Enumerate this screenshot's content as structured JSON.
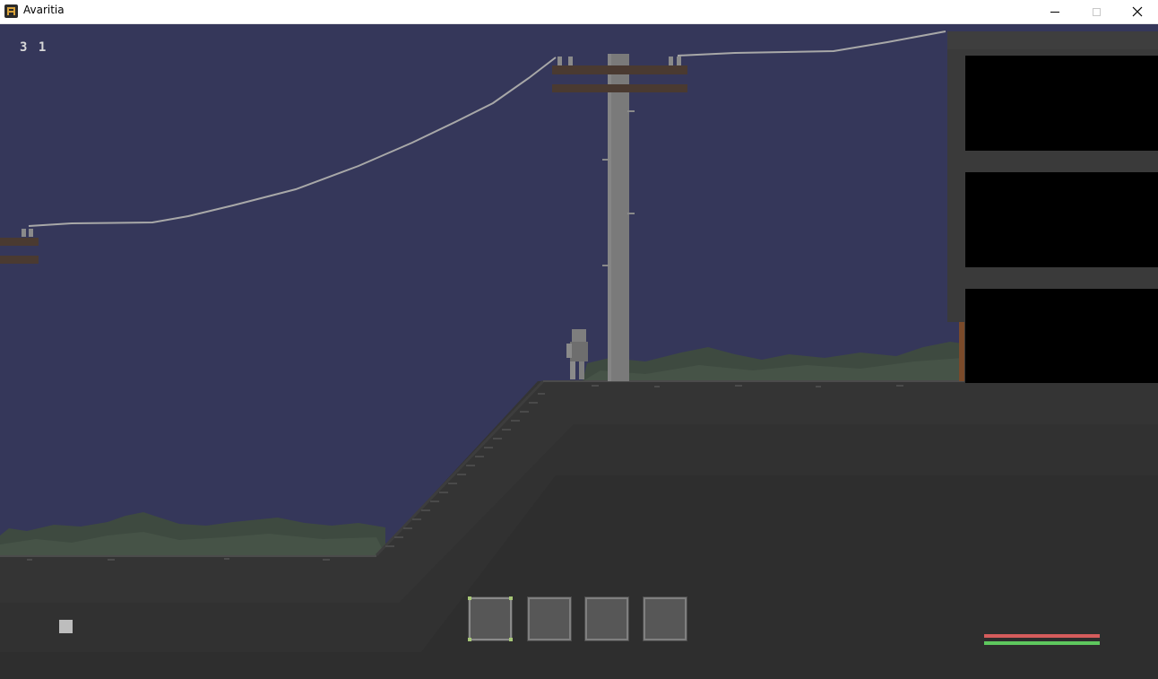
{
  "window": {
    "title": "Avaritia",
    "icon": "avaritia-app-icon",
    "controls": [
      "minimize-icon",
      "maximize-icon",
      "close-icon"
    ]
  },
  "hud": {
    "counter": "3 1",
    "hotbar": {
      "slots": 4,
      "selected_index": 0,
      "items": [
        "",
        "",
        "",
        ""
      ]
    },
    "health_fraction": 1.0,
    "stamina_fraction": 1.0
  },
  "colors": {
    "sky": "#35375a",
    "ground": "#343434",
    "grass": "#3e4a40",
    "pole": "#7a7a7a",
    "crossarm": "#4a3a31",
    "wire": "#a8a8a8",
    "building": "#3a3a3a",
    "window_dark": "#000000",
    "health": "#d55c5c",
    "stamina": "#5ec85e",
    "slot_highlight": "#a8c878"
  }
}
